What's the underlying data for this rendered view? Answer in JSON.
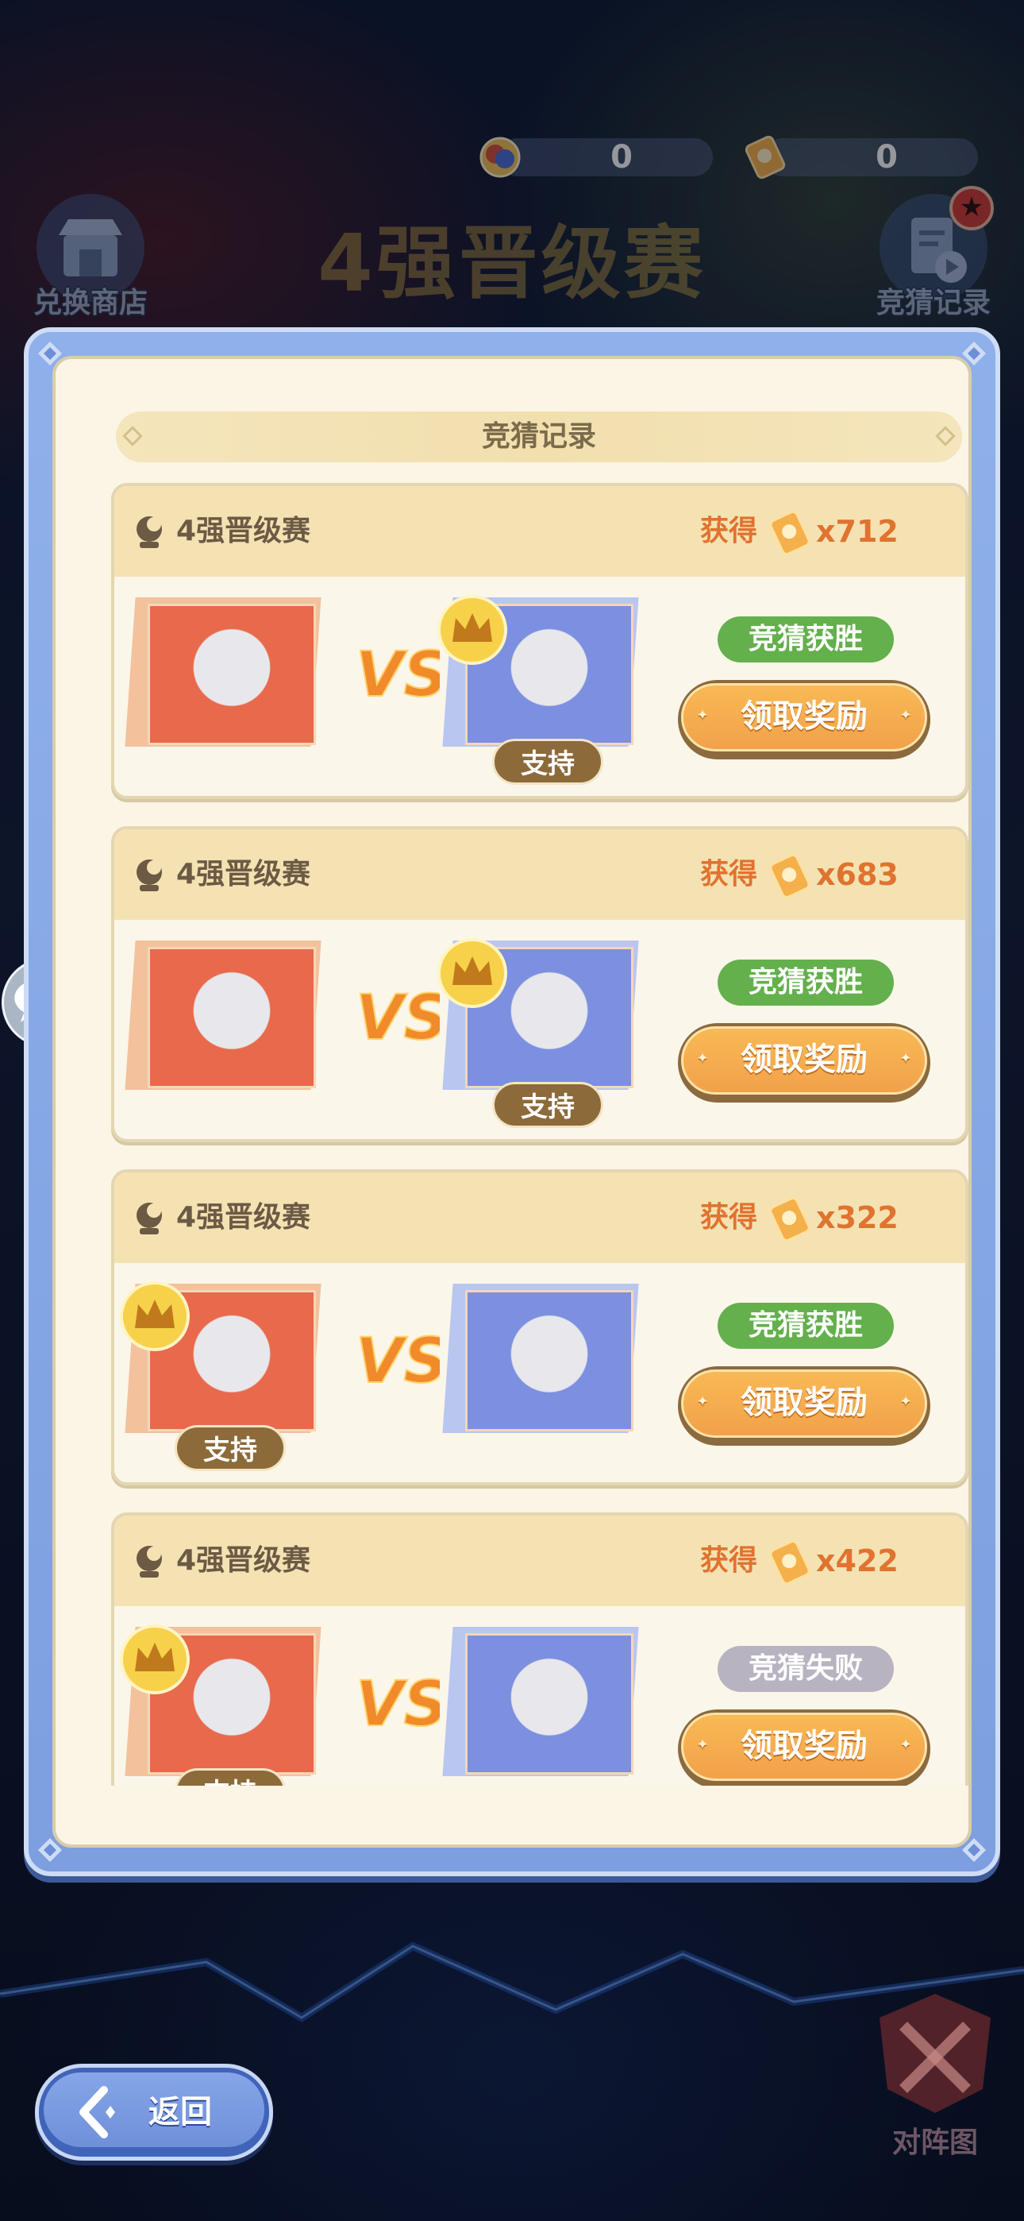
{
  "header": {
    "currencies": [
      {
        "icon": "star-coin-icon",
        "value": "0"
      },
      {
        "icon": "ticket-icon",
        "value": "0"
      }
    ],
    "shop_label": "兑换商店",
    "record_label": "竞猜记录",
    "stage_title": "4强晋级赛",
    "record_badge": "★"
  },
  "modal": {
    "title": "竞猜记录",
    "cards": [
      {
        "name": "4强晋级赛",
        "gain_label": "获得",
        "amount": "x712",
        "supported": "right",
        "support_label": "支持",
        "result": "竞猜获胜",
        "result_type": "win",
        "claim_label": "领取奖励",
        "left_color": "#e8694c",
        "right_color": "#7c8fe0"
      },
      {
        "name": "4强晋级赛",
        "gain_label": "获得",
        "amount": "x683",
        "supported": "right",
        "support_label": "支持",
        "result": "竞猜获胜",
        "result_type": "win",
        "claim_label": "领取奖励",
        "left_color": "#e8694c",
        "right_color": "#7c8fe0"
      },
      {
        "name": "4强晋级赛",
        "gain_label": "获得",
        "amount": "x322",
        "supported": "left",
        "support_label": "支持",
        "result": "竞猜获胜",
        "result_type": "win",
        "claim_label": "领取奖励",
        "left_color": "#e8694c",
        "right_color": "#7c8fe0"
      },
      {
        "name": "4强晋级赛",
        "gain_label": "获得",
        "amount": "x422",
        "supported": "left",
        "support_label": "支持",
        "result": "竞猜失败",
        "result_type": "lose",
        "claim_label": "领取奖励",
        "left_color": "#e8694c",
        "right_color": "#7c8fe0"
      }
    ]
  },
  "footer": {
    "back_label": "返回",
    "formation_label": "对阵图"
  },
  "colors": {
    "accent_orange": "#e0732f",
    "win_green": "#63b04c",
    "lose_gray": "#b8b3c0",
    "frame_blue": "#8fb0ea"
  }
}
